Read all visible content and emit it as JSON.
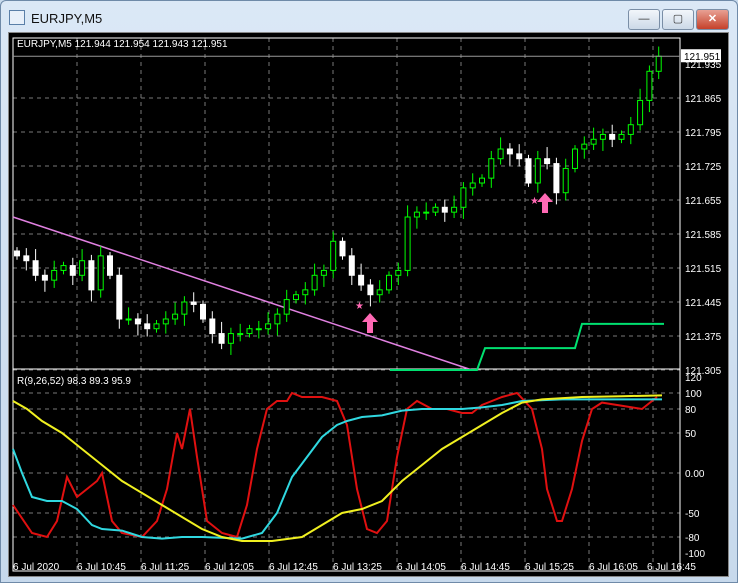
{
  "window": {
    "title": "EURJPY,M5",
    "minimize": "—",
    "maximize": "▢",
    "close": "✕"
  },
  "main": {
    "header": "EURJPY,M5  121.944 121.954 121.943 121.951",
    "current_price": "121.951",
    "price_labels": [
      "121.935",
      "121.865",
      "121.795",
      "121.725",
      "121.655",
      "121.585",
      "121.515",
      "121.445",
      "121.375",
      "121.305"
    ],
    "colors": {
      "bull": "#00ff00",
      "bear": "#ffffff",
      "trend": "#e080e0",
      "step": "#00e070",
      "marker": "#ff69b4"
    }
  },
  "indicator": {
    "header": "R(9,26,52) 98.3 89.3 95.9",
    "levels": [
      "120",
      "100",
      "80",
      "50",
      "0.00",
      "-50",
      "-80",
      "-100"
    ]
  },
  "time_labels": [
    "6 Jul 2020",
    "6 Jul 10:45",
    "6 Jul 11:25",
    "6 Jul 12:05",
    "6 Jul 12:45",
    "6 Jul 13:25",
    "6 Jul 14:05",
    "6 Jul 14:45",
    "6 Jul 15:25",
    "6 Jul 16:05",
    "6 Jul 16:45"
  ],
  "chart_data": {
    "type": "candlestick",
    "symbol": "EURJPY",
    "timeframe": "M5",
    "ylim": [
      121.305,
      121.951
    ],
    "closes": [
      121.54,
      121.53,
      121.5,
      121.49,
      121.51,
      121.52,
      121.5,
      121.53,
      121.47,
      121.54,
      121.5,
      121.41,
      121.41,
      121.4,
      121.39,
      121.4,
      121.41,
      121.42,
      121.445,
      121.44,
      121.41,
      121.38,
      121.36,
      121.38,
      121.38,
      121.39,
      121.39,
      121.4,
      121.42,
      121.45,
      121.46,
      121.47,
      121.5,
      121.51,
      121.57,
      121.54,
      121.5,
      121.48,
      121.46,
      121.47,
      121.5,
      121.51,
      121.62,
      121.63,
      121.63,
      121.64,
      121.63,
      121.64,
      121.68,
      121.69,
      121.7,
      121.74,
      121.76,
      121.75,
      121.74,
      121.69,
      121.74,
      121.73,
      121.67,
      121.72,
      121.76,
      121.77,
      121.78,
      121.79,
      121.78,
      121.79,
      121.81,
      121.86,
      121.92,
      121.951
    ],
    "indicator_series": [
      {
        "name": "red",
        "color": "#e01010",
        "x": [
          0,
          19,
          34,
          44,
          54,
          64,
          74,
          84,
          89,
          99,
          109,
          129,
          144,
          154,
          164,
          169,
          177,
          184,
          194,
          209,
          224,
          234,
          244,
          254,
          264,
          274,
          279,
          289,
          309,
          324,
          334,
          344,
          354,
          364,
          374,
          384,
          394,
          404,
          419,
          434,
          449,
          459,
          469,
          489,
          504,
          519,
          529,
          534,
          544,
          549,
          559,
          569,
          579,
          589,
          629,
          644
        ],
        "y": [
          -40,
          -75,
          -80,
          -60,
          -5,
          -30,
          -20,
          -10,
          0,
          -60,
          -75,
          -80,
          -60,
          -20,
          50,
          30,
          80,
          20,
          -60,
          -75,
          -80,
          -40,
          30,
          80,
          90,
          90,
          100,
          95,
          95,
          90,
          60,
          -20,
          -70,
          -75,
          -60,
          20,
          80,
          90,
          80,
          80,
          75,
          75,
          85,
          95,
          100,
          80,
          30,
          -20,
          -60,
          -60,
          -20,
          40,
          80,
          88,
          80,
          95
        ]
      },
      {
        "name": "cyan",
        "color": "#30d8e0",
        "x": [
          0,
          9,
          19,
          34,
          49,
          64,
          79,
          89,
          109,
          129,
          149,
          169,
          189,
          229,
          249,
          264,
          279,
          294,
          309,
          324,
          334,
          349,
          369,
          389,
          409,
          449,
          469,
          489,
          509,
          549,
          589,
          649
        ],
        "y": [
          30,
          0,
          -30,
          -35,
          -35,
          -45,
          -65,
          -70,
          -72,
          -80,
          -82,
          -80,
          -80,
          -82,
          -75,
          -50,
          -5,
          20,
          45,
          60,
          65,
          70,
          72,
          78,
          80,
          80,
          82,
          85,
          90,
          92,
          92,
          92
        ]
      },
      {
        "name": "yellow",
        "color": "#f0f020",
        "x": [
          0,
          14,
          29,
          49,
          69,
          89,
          109,
          129,
          149,
          169,
          189,
          209,
          229,
          259,
          289,
          309,
          329,
          349,
          369,
          389,
          409,
          429,
          449,
          469,
          489,
          509,
          529,
          569,
          609,
          649
        ],
        "y": [
          90,
          80,
          65,
          50,
          30,
          10,
          -10,
          -25,
          -40,
          -55,
          -70,
          -80,
          -85,
          -85,
          -80,
          -65,
          -50,
          -45,
          -35,
          -10,
          10,
          30,
          45,
          60,
          75,
          88,
          92,
          95,
          96,
          97
        ]
      }
    ]
  }
}
